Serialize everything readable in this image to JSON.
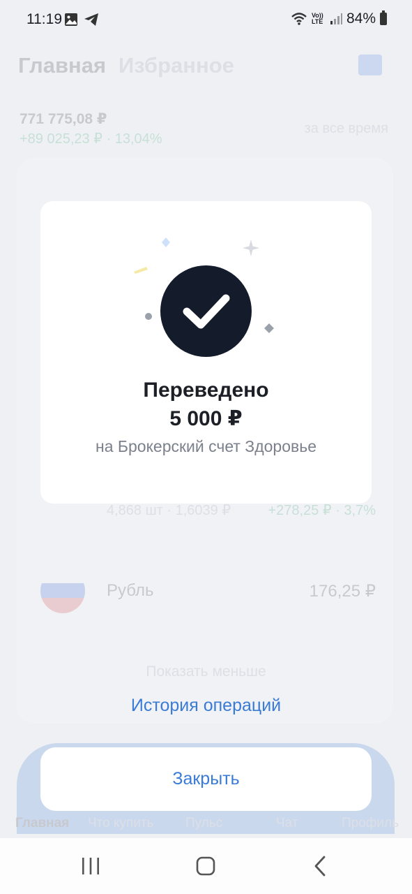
{
  "status_bar": {
    "time": "11:19",
    "volte_label": "Vo)) LTE",
    "battery": "84%"
  },
  "background": {
    "tabs": [
      "Главная",
      "Избранное"
    ],
    "portfolio_total": "771 775,08 ₽",
    "portfolio_gain": "+89 025,23 ₽ · 13,04%",
    "period": "за все время",
    "row_meta": "4,868 шт · 1,6039 ₽",
    "row_gain": "+278,25 ₽ · 3,7%",
    "ruble_name": "Рубль",
    "ruble_value": "176,25 ₽",
    "show_less": "Показать меньше",
    "bottom_nav": [
      "Главная",
      "Что купить",
      "Пульс",
      "Чат",
      "Профиль"
    ]
  },
  "history_link": "История операций",
  "dialog": {
    "title": "Переведено",
    "amount": "5 000 ₽",
    "subtitle": "на Брокерский счет Здоровье"
  },
  "close_button": "Закрыть",
  "colors": {
    "accent": "#3a7bd5",
    "check_bg": "#141c2c",
    "overlay": "#eef0f4"
  }
}
